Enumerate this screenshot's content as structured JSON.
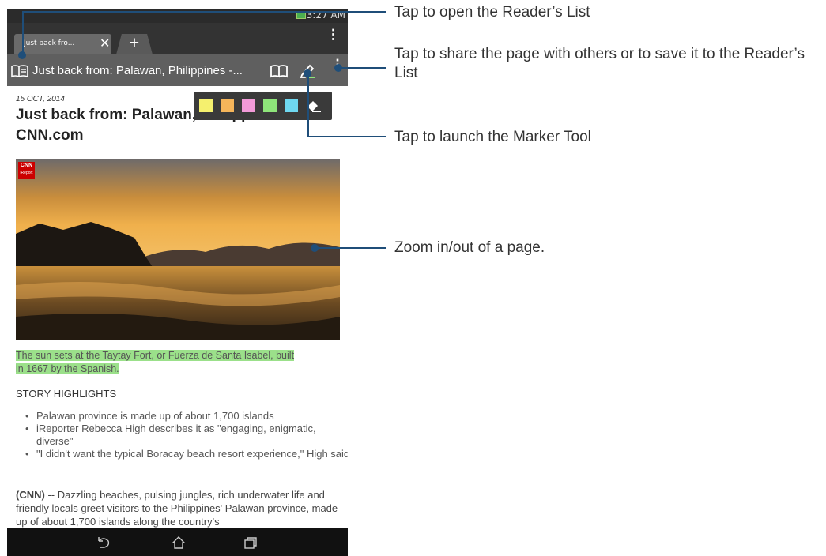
{
  "status_bar": {
    "time": "3:27 AM"
  },
  "tab": {
    "title": "Just back fro...",
    "close_glyph": "✕",
    "new_tab_glyph": "+"
  },
  "toolbar": {
    "page_title": "Just back from: Palawan, Philippines -...",
    "menu_glyph": "⋮",
    "icons": [
      "reader-list-icon",
      "reader-mode-icon",
      "marker-icon",
      "overflow-menu-icon"
    ]
  },
  "article": {
    "date": "15 OCT, 2014",
    "headline_line1": "Just back from: Palawan, Philippines -",
    "headline_line2": "CNN.com",
    "image_badge": "CNN",
    "image_badge_sub": "iReport",
    "caption_line1": "The sun sets at the Taytay Fort, or Fuerza de Santa Isabel, built",
    "caption_line2": "in 1667 by the Spanish.",
    "section_title": "STORY HIGHLIGHTS",
    "highlights": [
      "Palawan province is made up of about 1,700 islands",
      "iReporter Rebecca High describes it as \"engaging, enigmatic, diverse\"",
      "\"I didn't want the typical Boracay beach resort experience,\" High said"
    ],
    "body_prefix": "(CNN)",
    "body_text": " -- Dazzling beaches, pulsing jungles, rich underwater life and friendly locals greet visitors to the Philippines' Palawan province, made up of about 1,700 islands along the country's"
  },
  "marker_tool": {
    "colors": [
      "#f5f06e",
      "#f5b55a",
      "#f29ad8",
      "#8ee57a",
      "#6fd8f0"
    ]
  },
  "callouts": [
    {
      "text": "Tap to open the Reader’s List"
    },
    {
      "text": "Tap to share the page with others or to save it to the Reader’s List"
    },
    {
      "text": "Tap to launch the Marker Tool"
    },
    {
      "text": "Zoom in/out of a page."
    }
  ],
  "colors": {
    "callout": "#1f4e79",
    "caption_highlight": "#9be08a"
  }
}
